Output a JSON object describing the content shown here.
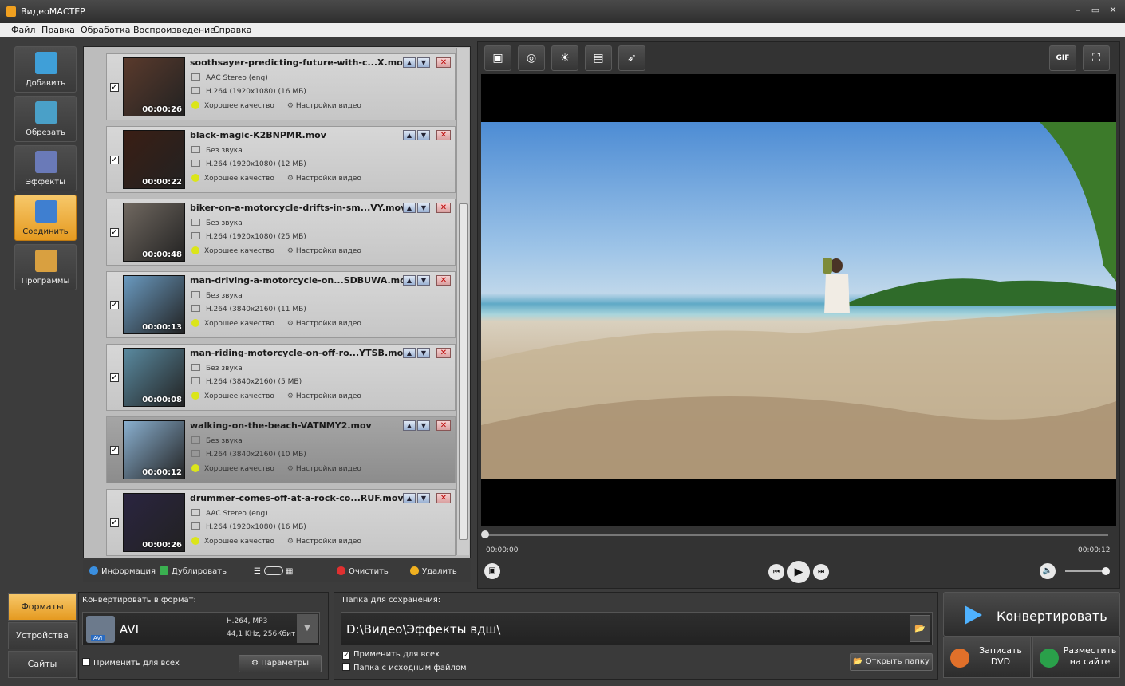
{
  "window": {
    "title": "ВидеоМАСТЕР",
    "min": "–",
    "max": "▭",
    "close": "✕"
  },
  "menu": [
    "Файл",
    "Правка",
    "Обработка",
    "Воспроизведение",
    "Справка"
  ],
  "tools": [
    {
      "label": "Добавить",
      "icon": "add-video-icon",
      "color": "#3f9fd8"
    },
    {
      "label": "Обрезать",
      "icon": "cut-icon",
      "color": "#4aa0c8"
    },
    {
      "label": "Эффекты",
      "icon": "effects-wand-icon",
      "color": "#6a7ab8"
    },
    {
      "label": "Соединить",
      "icon": "join-icon",
      "color": "#3f7fd0"
    },
    {
      "label": "Программы",
      "icon": "programs-icon",
      "color": "#d9a040"
    }
  ],
  "files": [
    {
      "name": "soothsayer-predicting-future-with-c...X.mov",
      "audio": "AAC Stereo (eng)",
      "video": "H.264 (1920x1080) (16 МБ)",
      "quality": "Хорошее качество",
      "settings": "Настройки видео",
      "duration": "00:00:26",
      "thumb": "#5a3a2c"
    },
    {
      "name": "black-magic-K2BNPMR.mov",
      "audio": "Без звука",
      "video": "H.264 (1920x1080) (12 МБ)",
      "quality": "Хорошее качество",
      "settings": "Настройки видео",
      "duration": "00:00:22",
      "thumb": "#3a1e14"
    },
    {
      "name": "biker-on-a-motorcycle-drifts-in-sm...VY.mov",
      "audio": "Без звука",
      "video": "H.264 (1920x1080) (25 МБ)",
      "quality": "Хорошее качество",
      "settings": "Настройки видео",
      "duration": "00:00:48",
      "thumb": "#706860"
    },
    {
      "name": "man-driving-a-motorcycle-on...SDBUWA.mov",
      "audio": "Без звука",
      "video": "H.264 (3840x2160) (11 МБ)",
      "quality": "Хорошее качество",
      "settings": "Настройки видео",
      "duration": "00:00:13",
      "thumb": "#6a9ac0"
    },
    {
      "name": "man-riding-motorcycle-on-off-ro...YTSB.mov",
      "audio": "Без звука",
      "video": "H.264 (3840x2160) (5 МБ)",
      "quality": "Хорошее качество",
      "settings": "Настройки видео",
      "duration": "00:00:08",
      "thumb": "#5a8aa0"
    },
    {
      "name": "walking-on-the-beach-VATNMY2.mov",
      "audio": "Без звука",
      "video": "H.264 (3840x2160) (10 МБ)",
      "quality": "Хорошее качество",
      "settings": "Настройки видео",
      "duration": "00:00:12",
      "thumb": "#8ab0d0"
    },
    {
      "name": "drummer-comes-off-at-a-rock-co...RUF.mov",
      "audio": "AAC Stereo (eng)",
      "video": "H.264 (1920x1080) (16 МБ)",
      "quality": "Хорошее качество",
      "settings": "Настройки видео",
      "duration": "00:00:26",
      "thumb": "#2a2440"
    }
  ],
  "list_footer": {
    "info": "Информация",
    "duplicate": "Дублировать",
    "clear": "Очистить",
    "delete": "Удалить"
  },
  "preview": {
    "time_start": "00:00:00",
    "time_end": "00:00:12",
    "gif": "GIF",
    "tools": [
      "crop-icon",
      "stabilize-icon",
      "brightness-icon",
      "frames-icon",
      "speed-icon"
    ]
  },
  "format_tabs": [
    "Форматы",
    "Устройства",
    "Сайты"
  ],
  "convert": {
    "label": "Конвертировать в формат:",
    "format": "AVI",
    "format_badge": "AVI",
    "codec": "H.264, MP3",
    "audio": "44,1 KHz, 256Кбит",
    "apply_all": "Применить для всех",
    "params": "Параметры"
  },
  "save": {
    "label": "Папка для сохранения:",
    "path": "D:\\Видео\\Эффекты вдш\\",
    "apply_all": "Применить для всех",
    "source_folder": "Папка с исходным файлом",
    "open": "Открыть папку"
  },
  "actions": {
    "convert": "Конвертировать",
    "dvd_1": "Записать",
    "dvd_2": "DVD",
    "site_1": "Разместить",
    "site_2": "на сайте"
  }
}
